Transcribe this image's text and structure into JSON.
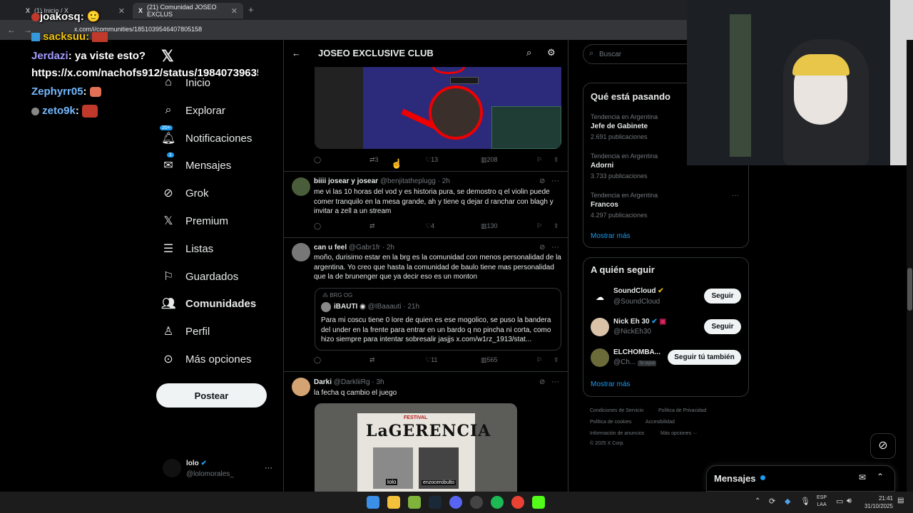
{
  "browser": {
    "tabs": [
      {
        "label": "(1) Inicio / X"
      },
      {
        "label": "(21) Comunidad JOSEO EXCLUS"
      }
    ],
    "url": "x.com/i/communities/1851039546407805158"
  },
  "chat": [
    {
      "user": "joakosq",
      "text": ""
    },
    {
      "user": "sacksuu",
      "text": ""
    },
    {
      "user": "Jerdazi",
      "text": "ya viste esto?"
    },
    {
      "user": "",
      "text": "https://x.com/nachofs912/status/19840739635"
    },
    {
      "user": "Zephyrr05",
      "text": ""
    },
    {
      "user": "zeto9k",
      "text": ""
    }
  ],
  "nav": {
    "items": [
      {
        "label": "Inicio",
        "icon": "home-icon"
      },
      {
        "label": "Explorar",
        "icon": "search-icon"
      },
      {
        "label": "Notificaciones",
        "icon": "bell-icon",
        "badge": "20+"
      },
      {
        "label": "Mensajes",
        "icon": "mail-icon",
        "badge": "1"
      },
      {
        "label": "Grok",
        "icon": "grok-icon"
      },
      {
        "label": "Premium",
        "icon": "x-icon"
      },
      {
        "label": "Listas",
        "icon": "list-icon"
      },
      {
        "label": "Guardados",
        "icon": "bookmark-icon"
      },
      {
        "label": "Comunidades",
        "icon": "people-icon"
      },
      {
        "label": "Perfil",
        "icon": "person-icon"
      },
      {
        "label": "Más opciones",
        "icon": "more-icon"
      }
    ],
    "post_label": "Postear",
    "account": {
      "name": "lolo",
      "handle": "@lolomorales_"
    }
  },
  "community": {
    "title": "JOSEO EXCLUSIVE CLUB"
  },
  "tweets": [
    {
      "stats": {
        "reply": "",
        "retweet": "3",
        "like": "13",
        "views": "208"
      }
    },
    {
      "name": "biiii josear y josear",
      "handle": "@benjitatheplugg · 2h",
      "text": "me vi las 10 horas del vod y es historia pura, se demostro q el violin puede comer tranquilo en la mesa grande, ah y tiene q dejar d ranchar con blagh y invitar a zell a un stream",
      "stats": {
        "reply": "",
        "retweet": "",
        "like": "4",
        "views": "130"
      }
    },
    {
      "name": "can u feel",
      "handle": "@Gabr1fr · 2h",
      "text": "moño, durisimo estar en la brg es la comunidad con menos personalidad de la argentina. Yo creo que hasta la comunidad de baulo tiene mas personalidad que la de brunenger que ya decir eso es un monton",
      "quote": {
        "community": "BRG OG",
        "name": "iBAUTI",
        "handle": "@IBaaauti · 21h",
        "text": "Para mi coscu tiene 0 lore de quien es ese mogolico, se puso la bandera del under en la frente para entrar en un bardo q no pincha ni corta, como hizo siempre para intentar sobresalir jasjjs x.com/w1rz_1913/stat..."
      },
      "stats": {
        "reply": "",
        "retweet": "",
        "like": "11",
        "views": "565"
      }
    },
    {
      "name": "Darki",
      "handle": "@DarkliiRg · 3h",
      "text": "la fecha q cambio el juego",
      "image_text": "LaGERENCIA",
      "image_sub": "FESTIVAL",
      "image_names": [
        "lolo",
        "enzocerobulto"
      ]
    }
  ],
  "search": {
    "placeholder": "Buscar"
  },
  "trends": {
    "title": "Qué está pasando",
    "items": [
      {
        "context": "Tendencia en Argentina",
        "name": "Jefe de Gabinete",
        "count": "2.691 publicaciones"
      },
      {
        "context": "Tendencia en Argentina",
        "name": "Adorni",
        "count": "3.733 publicaciones"
      },
      {
        "context": "Tendencia en Argentina",
        "name": "Francos",
        "count": "4.297 publicaciones"
      }
    ],
    "more": "Mostrar más"
  },
  "who_to_follow": {
    "title": "A quién seguir",
    "items": [
      {
        "name": "SoundCloud",
        "handle": "@SoundCloud",
        "button": "Seguir"
      },
      {
        "name": "Nick Eh 30",
        "handle": "@NickEh30",
        "button": "Seguir"
      },
      {
        "name": "ELCHOMBA...",
        "handle": "@Ch...",
        "tag": "Te sigue",
        "button": "Seguir tú también"
      }
    ],
    "more": "Mostrar más"
  },
  "footer": {
    "links": [
      "Condiciones de Servicio",
      "Política de Privacidad",
      "Política de cookies",
      "Accesibilidad",
      "Información de anuncios",
      "Más opciones ···"
    ],
    "copyright": "© 2025 X Corp."
  },
  "messages": {
    "title": "Mensajes"
  },
  "taskbar": {
    "lang1": "ESP",
    "lang2": "LAA",
    "time": "21:41",
    "date": "31/10/2025"
  },
  "colors": {
    "accent": "#1d9bf0",
    "bg": "#000000",
    "border": "#2f3336",
    "muted": "#71767b"
  }
}
